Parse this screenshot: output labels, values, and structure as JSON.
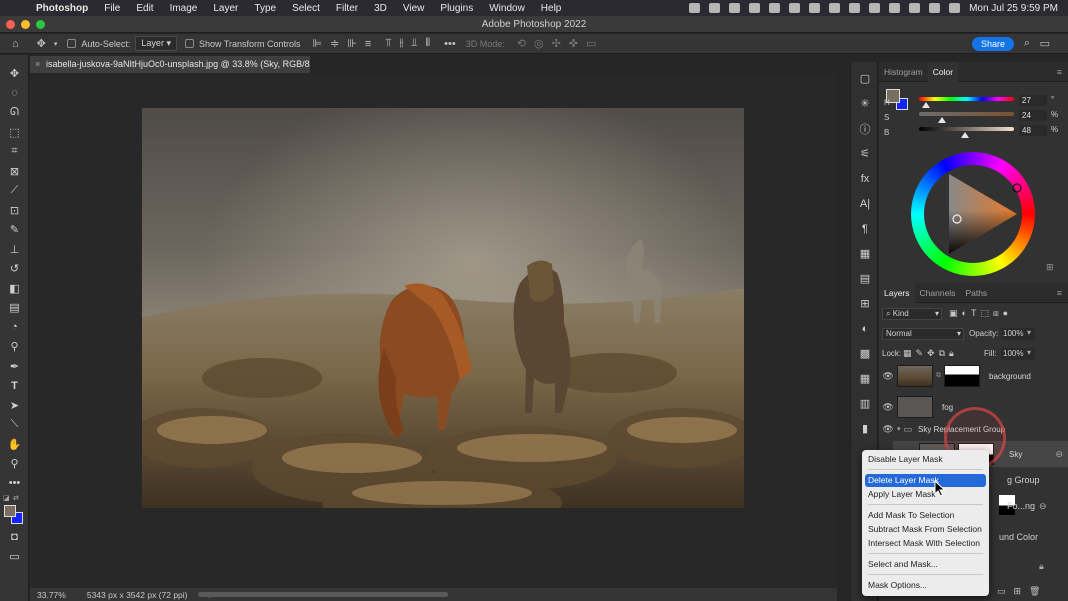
{
  "menubar": {
    "app": "Photoshop",
    "items": [
      "File",
      "Edit",
      "Image",
      "Layer",
      "Type",
      "Select",
      "Filter",
      "3D",
      "View",
      "Plugins",
      "Window",
      "Help"
    ],
    "clock": "Mon Jul 25  9:59 PM"
  },
  "window": {
    "title": "Adobe Photoshop 2022"
  },
  "options": {
    "auto_select": "Auto-Select:",
    "auto_select_target": "Layer",
    "show_transform": "Show Transform Controls",
    "mode_3d": "3D Mode:",
    "share": "Share"
  },
  "document": {
    "tab_title": "isabella-juskova-9aNItHjuOc0-unsplash.jpg @ 33.8% (Sky, RGB/8*) *",
    "zoom": "33.77%",
    "size_info": "5343 px x 3542 px (72 ppi)"
  },
  "color_panel": {
    "tabs": [
      "Histogram",
      "Color"
    ],
    "active_tab": "Color",
    "sliders": [
      {
        "label": "H",
        "value": "27",
        "unit": "°",
        "fraction": 0.07
      },
      {
        "label": "S",
        "value": "24",
        "unit": "%",
        "fraction": 0.24
      },
      {
        "label": "B",
        "value": "48",
        "unit": "%",
        "fraction": 0.48
      }
    ],
    "foreground_color": "#7a6e60",
    "background_color": "#1424ff"
  },
  "layers_panel": {
    "tabs": [
      "Layers",
      "Channels",
      "Paths"
    ],
    "active_tab": "Layers",
    "filter_kind": "Kind",
    "blend_mode": "Normal",
    "opacity_label": "Opacity:",
    "opacity": "100%",
    "lock_label": "Lock:",
    "fill_label": "Fill:",
    "fill": "100%",
    "layers": [
      {
        "name": "background"
      },
      {
        "name": "fog"
      },
      {
        "name": "Sky Replacement Group"
      },
      {
        "name": "Sky"
      },
      {
        "name": "g Group"
      },
      {
        "name": "Fo...ng"
      },
      {
        "name": "und Color"
      }
    ]
  },
  "context_menu": {
    "items": [
      "Disable Layer Mask",
      "Delete Layer Mask",
      "Apply Layer Mask",
      "Add Mask To Selection",
      "Subtract Mask From Selection",
      "Intersect Mask With Selection",
      "Select and Mask...",
      "Mask Options..."
    ],
    "selected": "Delete Layer Mask"
  }
}
